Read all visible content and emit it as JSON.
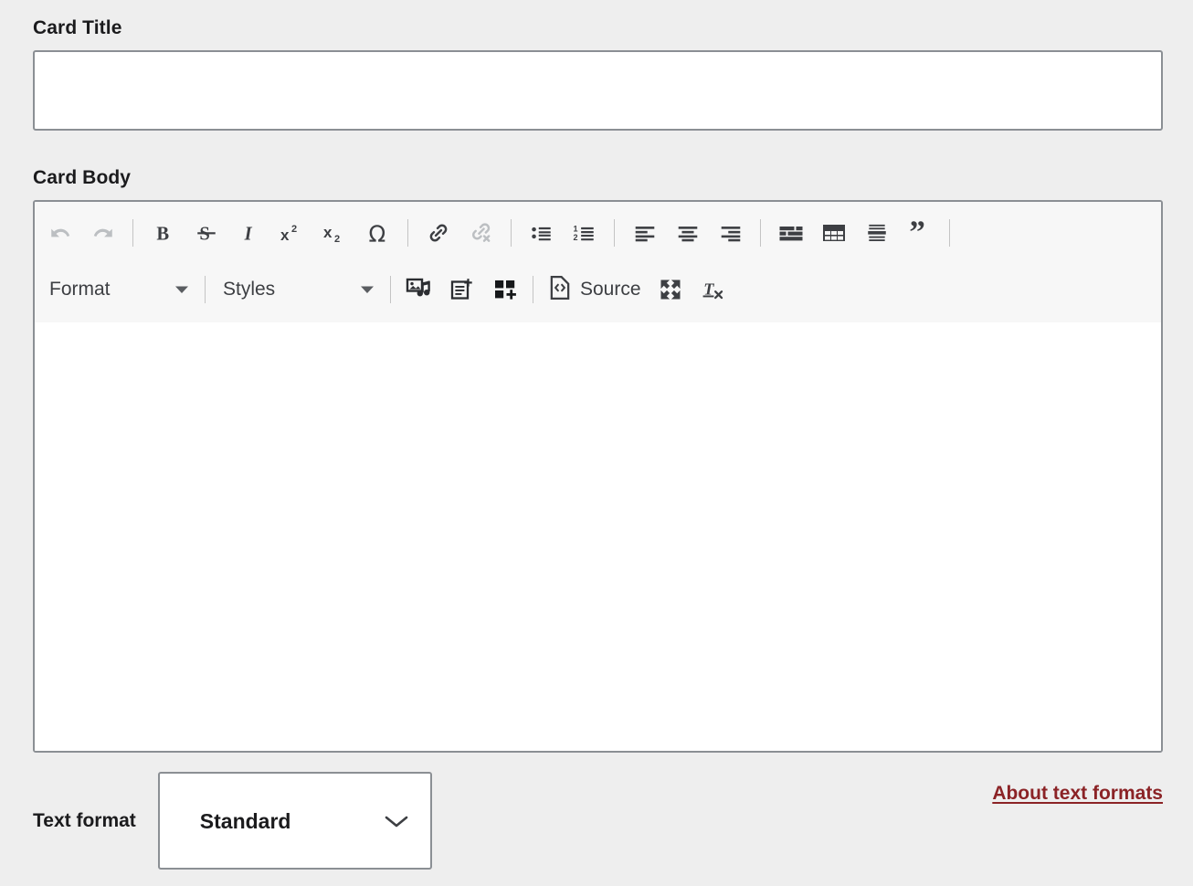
{
  "form": {
    "title_field": {
      "label": "Card Title",
      "value": "",
      "placeholder": ""
    },
    "body_field": {
      "label": "Card Body",
      "value": "",
      "placeholder": ""
    }
  },
  "editor": {
    "toolbar_rows": [
      {
        "row": 1,
        "items": [
          {
            "type": "button",
            "name": "undo",
            "label": "Undo",
            "icon": "undo-icon",
            "disabled": true
          },
          {
            "type": "button",
            "name": "redo",
            "label": "Redo",
            "icon": "redo-icon",
            "disabled": true
          },
          {
            "type": "separator"
          },
          {
            "type": "button",
            "name": "bold",
            "label": "Bold",
            "icon": "bold-icon",
            "disabled": false
          },
          {
            "type": "button",
            "name": "strikethrough",
            "label": "Strikethrough",
            "icon": "strikethrough-icon",
            "disabled": false
          },
          {
            "type": "button",
            "name": "italic",
            "label": "Italic",
            "icon": "italic-icon",
            "disabled": false
          },
          {
            "type": "button",
            "name": "superscript",
            "label": "Superscript",
            "icon": "superscript-icon",
            "disabled": false
          },
          {
            "type": "button",
            "name": "subscript",
            "label": "Subscript",
            "icon": "subscript-icon",
            "disabled": false
          },
          {
            "type": "button",
            "name": "special-character",
            "label": "Special characters",
            "icon": "omega-icon",
            "disabled": false
          },
          {
            "type": "separator"
          },
          {
            "type": "button",
            "name": "link",
            "label": "Link",
            "icon": "link-icon",
            "disabled": false
          },
          {
            "type": "button",
            "name": "unlink",
            "label": "Unlink",
            "icon": "unlink-icon",
            "disabled": true
          },
          {
            "type": "separator"
          },
          {
            "type": "button",
            "name": "bulleted-list",
            "label": "Bulleted List",
            "icon": "bulleted-list-icon",
            "disabled": false
          },
          {
            "type": "button",
            "name": "numbered-list",
            "label": "Numbered List",
            "icon": "numbered-list-icon",
            "disabled": false
          },
          {
            "type": "separator"
          },
          {
            "type": "button",
            "name": "align-left",
            "label": "Align left",
            "icon": "align-left-icon",
            "disabled": false
          },
          {
            "type": "button",
            "name": "align-center",
            "label": "Align center",
            "icon": "align-center-icon",
            "disabled": false
          },
          {
            "type": "button",
            "name": "align-right",
            "label": "Align right",
            "icon": "align-right-icon",
            "disabled": false
          },
          {
            "type": "separator"
          },
          {
            "type": "button",
            "name": "insert-layout",
            "label": "Insert layout",
            "icon": "layout-grid-icon",
            "disabled": false
          },
          {
            "type": "button",
            "name": "insert-table",
            "label": "Insert table",
            "icon": "table-icon",
            "disabled": false
          },
          {
            "type": "button",
            "name": "horizontal-rule",
            "label": "Horizontal line",
            "icon": "horizontal-rule-icon",
            "disabled": false
          },
          {
            "type": "button",
            "name": "block-quote",
            "label": "Block quote",
            "icon": "blockquote-icon",
            "disabled": false
          },
          {
            "type": "separator"
          }
        ]
      },
      {
        "row": 2,
        "items": [
          {
            "type": "dropdown",
            "name": "format",
            "label": "Format",
            "value": "Format"
          },
          {
            "type": "separator"
          },
          {
            "type": "dropdown",
            "name": "styles",
            "label": "Styles",
            "value": "Styles"
          },
          {
            "type": "separator"
          },
          {
            "type": "button",
            "name": "media-library",
            "label": "Insert Media",
            "icon": "media-library-icon",
            "disabled": false
          },
          {
            "type": "button",
            "name": "insert-template",
            "label": "Insert template",
            "icon": "template-icon",
            "disabled": false
          },
          {
            "type": "button",
            "name": "add-component",
            "label": "Add component",
            "icon": "component-grid-icon",
            "disabled": false
          },
          {
            "type": "separator"
          },
          {
            "type": "button-text",
            "name": "source",
            "label": "Source",
            "icon": "source-code-icon",
            "disabled": false
          },
          {
            "type": "button",
            "name": "fullscreen",
            "label": "Fullscreen",
            "icon": "fullscreen-icon",
            "disabled": false
          },
          {
            "type": "button",
            "name": "remove-format",
            "label": "Remove format",
            "icon": "remove-format-icon",
            "disabled": false
          }
        ]
      }
    ],
    "labels": {
      "format_dropdown": "Format",
      "styles_dropdown": "Styles",
      "source_button": "Source"
    }
  },
  "footer": {
    "text_format_label": "Text format",
    "text_format_value": "Standard",
    "text_format_options": [
      "Standard"
    ],
    "about_link": "About text formats"
  },
  "colors": {
    "page_background": "#eeeeee",
    "field_border": "#8b8f94",
    "toolbar_background": "#f7f7f7",
    "editor_background": "#ffffff",
    "icon": "#3d3f43",
    "icon_disabled": "#bcbfc2",
    "text": "#1b1b1d",
    "link": "#8b2326",
    "separator": "#c4c4c4"
  }
}
